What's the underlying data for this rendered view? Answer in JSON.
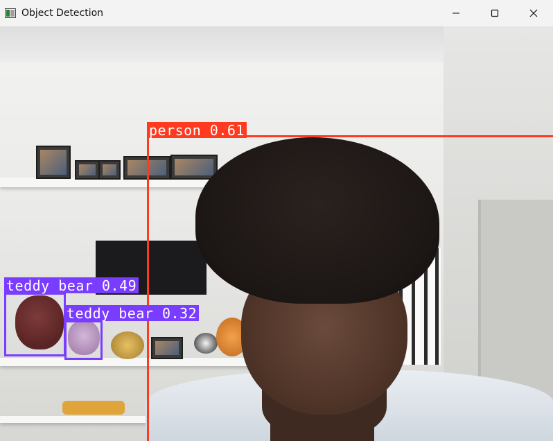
{
  "window": {
    "title": "Object Detection",
    "icon": "opencv-window-icon",
    "controls": [
      "minimize-icon",
      "maximize-icon",
      "close-icon"
    ]
  },
  "detections": [
    {
      "label": "person 0.61",
      "class": "person",
      "confidence": 0.61,
      "color": "#ff3b1f"
    },
    {
      "label": "teddy bear 0.49",
      "class": "teddy bear",
      "confidence": 0.49,
      "color": "#7a3cff"
    },
    {
      "label": "teddy bear 0.32",
      "class": "teddy bear",
      "confidence": 0.32,
      "color": "#7a3cff"
    }
  ]
}
